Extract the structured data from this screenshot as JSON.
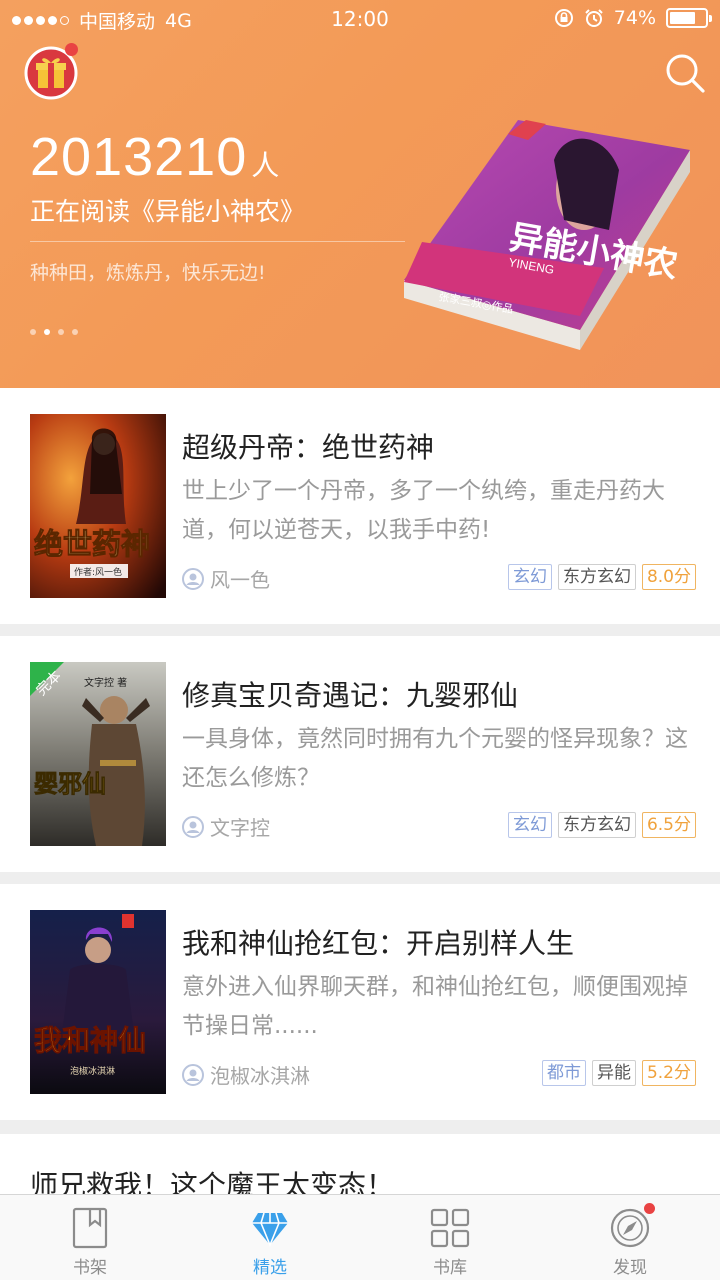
{
  "status_bar": {
    "carrier": "中国移动",
    "network": "4G",
    "time": "12:00",
    "battery": "74%",
    "battery_level": 0.74
  },
  "banner": {
    "count": "2013210",
    "count_unit": "人",
    "reading_text": "正在阅读《异能小神农》",
    "slogan": "种种田，炼炼丹，快乐无边!",
    "cover_title": "异能小神农",
    "cover_pinyin": "YINENG",
    "cover_author": "张家三叔◎作品",
    "page_total": 4,
    "page_current": 2
  },
  "books": [
    {
      "title": "超级丹帝：绝世药神",
      "desc": "世上少了一个丹帝，多了一个纨绔，重走丹药大道，何以逆苍天，以我手中药!",
      "author": "风一色",
      "tags": [
        "玄幻",
        "东方玄幻"
      ],
      "score": "8.0分",
      "cover_text": "绝世药神",
      "cover_sub": "作者:风一色"
    },
    {
      "title": "修真宝贝奇遇记：九婴邪仙",
      "desc": "一具身体，竟然同时拥有九个元婴的怪异现象？这还怎么修炼？",
      "author": "文字控",
      "tags": [
        "玄幻",
        "东方玄幻"
      ],
      "score": "6.5分",
      "badge": "完本",
      "cover_text": "婴邪仙",
      "cover_sub": "文字控 著"
    },
    {
      "title": "我和神仙抢红包：开启别样人生",
      "desc": "意外进入仙界聊天群，和神仙抢红包，顺便围观掉节操日常......",
      "author": "泡椒冰淇淋",
      "tags": [
        "都市",
        "异能"
      ],
      "score": "5.2分",
      "cover_text": "我和神仙",
      "cover_sub": "泡椒冰淇淋"
    },
    {
      "title": "师兄救我！这个魔王太变态！"
    }
  ],
  "tabs": [
    {
      "label": "书架",
      "icon": "bookmark-icon"
    },
    {
      "label": "精选",
      "icon": "diamond-icon",
      "active": true
    },
    {
      "label": "书库",
      "icon": "grid-icon"
    },
    {
      "label": "发现",
      "icon": "compass-icon",
      "badge": true
    }
  ],
  "colors": {
    "banner": "#f4a05f",
    "accent": "#3aa0ea",
    "score": "#f0a23c",
    "tag_blue": "#7e9ad6",
    "badge": "#e94343"
  }
}
